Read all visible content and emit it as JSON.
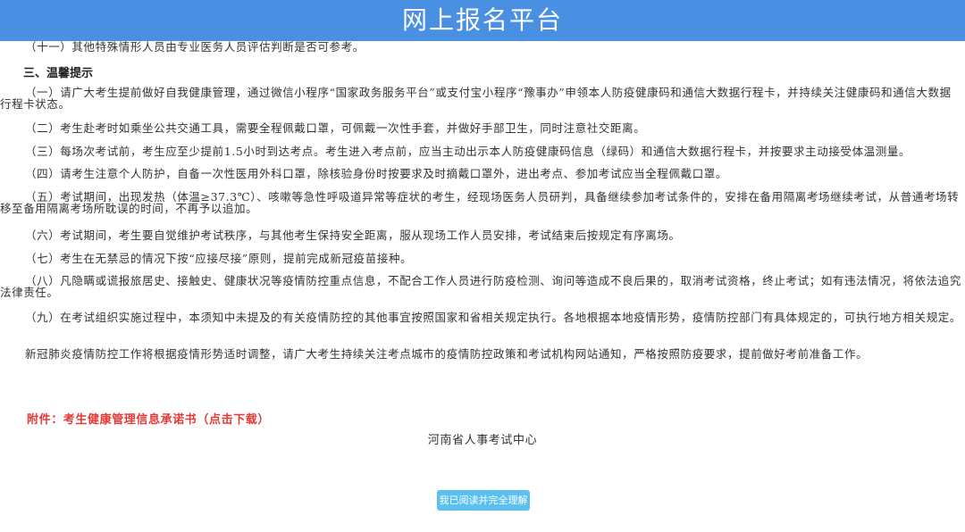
{
  "header": {
    "title": "网上报名平台"
  },
  "notice": {
    "item_11": "（十一）其他特殊情形人员由专业医务人员评估判断是否可参考。",
    "section_title": "三、温馨提示",
    "tips": [
      "（一）请广大考生提前做好自我健康管理，通过微信小程序“国家政务服务平台”或支付宝小程序“豫事办”申领本人防疫健康码和通信大数据行程卡，并持续关注健康码和通信大数据行程卡状态。",
      "（二）考生赴考时如乘坐公共交通工具，需要全程佩戴口罩，可佩戴一次性手套，并做好手部卫生，同时注意社交距离。",
      "（三）每场次考试前，考生应至少提前1.5小时到达考点。考生进入考点前，应当主动出示本人防疫健康码信息（绿码）和通信大数据行程卡，并按要求主动接受体温测量。",
      "（四）请考生注意个人防护，自备一次性医用外科口罩，除核验身份时按要求及时摘戴口罩外，进出考点、参加考试应当全程佩戴口罩。",
      "（五）考试期间，出现发热（体温≥37.3℃）、咳嗽等急性呼吸道异常等症状的考生，经现场医务人员研判，具备继续参加考试条件的，安排在备用隔离考场继续考试，从普通考场转移至备用隔离考场所耽误的时间，不再予以追加。",
      "（六）考试期间，考生要自觉维护考试秩序，与其他考生保持安全距离，服从现场工作人员安排，考试结束后按规定有序离场。",
      "（七）考生在无禁忌的情况下按“应接尽接”原则，提前完成新冠疫苗接种。",
      "（八）凡隐瞒或谎报旅居史、接触史、健康状况等疫情防控重点信息，不配合工作人员进行防疫检测、询问等造成不良后果的，取消考试资格，终止考试；如有违法情况，将依法追究法律责任。",
      "（九）在考试组织实施过程中，本须知中未提及的有关疫情防控的其他事宜按照国家和省相关规定执行。各地根据本地疫情形势，疫情防控部门有具体规定的，可执行地方相关规定。"
    ],
    "closing": "新冠肺炎疫情防控工作将根据疫情形势适时调整，请广大考生持续关注考点城市的疫情防控政策和考试机构网站通知，严格按照防疫要求，提前做好考前准备工作。"
  },
  "attachment": {
    "label": "附件：考生健康管理信息承诺书（点击下载）"
  },
  "organization": "河南省人事考试中心",
  "confirm_button": "我已阅读并完全理解",
  "colors": {
    "header_bg": "#4a90e2",
    "button_bg": "#5bc0f0",
    "attachment": "#e53935"
  }
}
